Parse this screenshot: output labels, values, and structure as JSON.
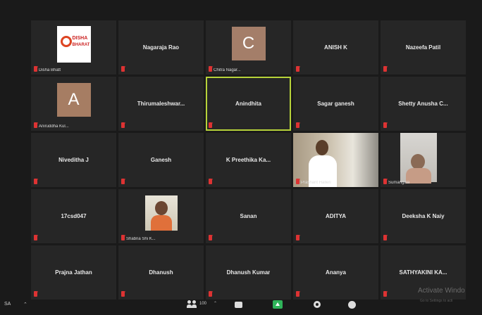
{
  "participants": [
    {
      "name": "",
      "caption": "Disha Bhatt",
      "type": "logo",
      "logo_line1": "DISHA",
      "logo_line2": "BHARAT"
    },
    {
      "name": "Nagaraja Rao",
      "caption": "",
      "type": "text"
    },
    {
      "name": "",
      "caption": "Chitra Nagar...",
      "type": "avatar",
      "initial": "C",
      "avatar_color": "#a47e69"
    },
    {
      "name": "ANISH K",
      "caption": "",
      "type": "text"
    },
    {
      "name": "Nazeefa Patil",
      "caption": "",
      "type": "text"
    },
    {
      "name": "",
      "caption": "Aniruddha Kul...",
      "type": "avatar",
      "initial": "A",
      "avatar_color": "#a67d63"
    },
    {
      "name": "Thirumaleshwar...",
      "caption": "",
      "type": "text"
    },
    {
      "name": "Anindhita",
      "caption": "",
      "type": "text",
      "active": true
    },
    {
      "name": "Sagar ganesh",
      "caption": "",
      "type": "text"
    },
    {
      "name": "Shetty Anusha C...",
      "caption": "",
      "type": "text"
    },
    {
      "name": "Niveditha J",
      "caption": "",
      "type": "text"
    },
    {
      "name": "Ganesh",
      "caption": "",
      "type": "text"
    },
    {
      "name": "K Preethika Ka...",
      "caption": "",
      "type": "text"
    },
    {
      "name": "",
      "caption": "Prashant Halleri",
      "type": "video1"
    },
    {
      "name": "",
      "caption": "Sumangala",
      "type": "video2"
    },
    {
      "name": "17csd047",
      "caption": "",
      "type": "text"
    },
    {
      "name": "",
      "caption": "Shabna Shi K...",
      "type": "photo"
    },
    {
      "name": "Sanan",
      "caption": "",
      "type": "text"
    },
    {
      "name": "ADITYA",
      "caption": "",
      "type": "text"
    },
    {
      "name": "Deeksha K Naiy",
      "caption": "",
      "type": "text"
    },
    {
      "name": "Prajna Jathan",
      "caption": "",
      "type": "text"
    },
    {
      "name": "Dhanush",
      "caption": "",
      "type": "text"
    },
    {
      "name": "Dhanush Kumar",
      "caption": "",
      "type": "text"
    },
    {
      "name": "Ananya",
      "caption": "",
      "type": "text"
    },
    {
      "name": "SATHYAKINI KA...",
      "caption": "",
      "type": "text"
    }
  ],
  "toolbar": {
    "left_label": "SA",
    "participant_count": "100",
    "icons": [
      "participants-icon",
      "chat-icon",
      "share-screen-icon",
      "record-icon",
      "reactions-icon"
    ]
  },
  "watermark": {
    "line1": "Activate Windo",
    "line2": "Go to Settings to acti"
  },
  "colors": {
    "active_border": "#b7d33a",
    "muted_mic": "#dd3333",
    "share_green": "#2fb45a"
  }
}
